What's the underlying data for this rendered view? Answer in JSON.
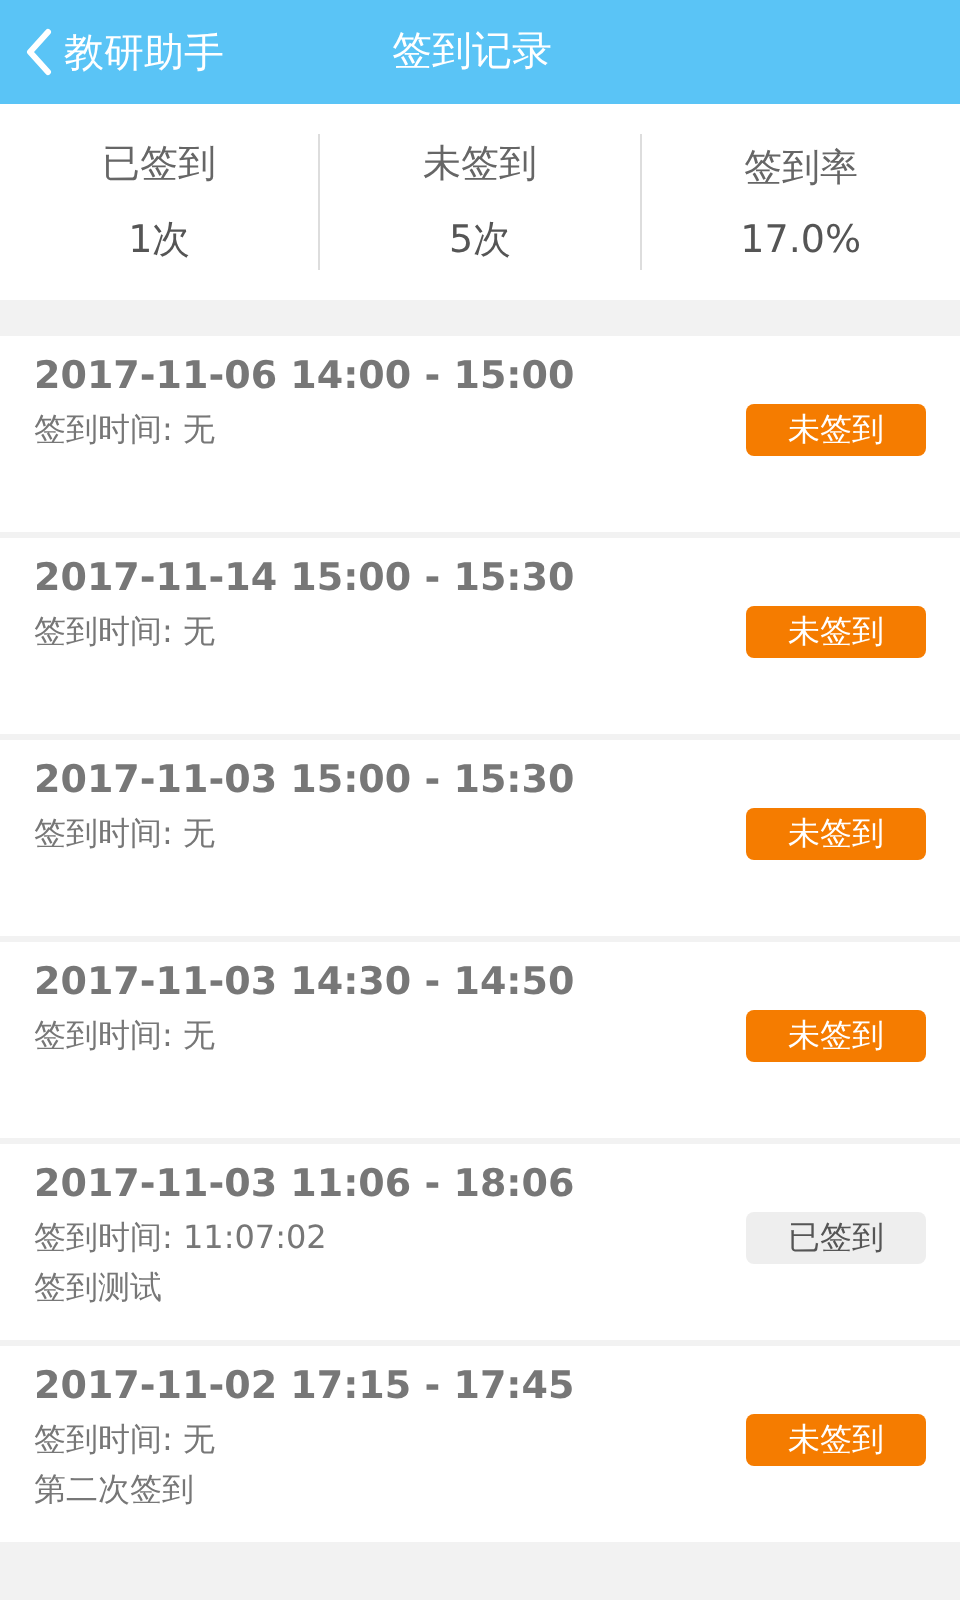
{
  "header": {
    "back_label": "教研助手",
    "title": "签到记录"
  },
  "stats": [
    {
      "label": "已签到",
      "value": "1次"
    },
    {
      "label": "未签到",
      "value": "5次"
    },
    {
      "label": "签到率",
      "value": "17.0%"
    }
  ],
  "records": [
    {
      "time_range": "2017-11-06 14:00 - 15:00",
      "checkin_time": "签到时间: 无",
      "status": "未签到",
      "signed": false
    },
    {
      "time_range": "2017-11-14 15:00 - 15:30",
      "checkin_time": "签到时间: 无",
      "status": "未签到",
      "signed": false
    },
    {
      "time_range": "2017-11-03 15:00 - 15:30",
      "checkin_time": "签到时间: 无",
      "status": "未签到",
      "signed": false
    },
    {
      "time_range": "2017-11-03 14:30 - 14:50",
      "checkin_time": "签到时间: 无",
      "status": "未签到",
      "signed": false
    },
    {
      "time_range": "2017-11-03 11:06 - 18:06",
      "checkin_time": "签到时间: 11:07:02",
      "note": "签到测试",
      "status": "已签到",
      "signed": true
    },
    {
      "time_range": "2017-11-02 17:15 - 17:45",
      "checkin_time": "签到时间: 无",
      "note": "第二次签到",
      "status": "未签到",
      "signed": false
    }
  ]
}
